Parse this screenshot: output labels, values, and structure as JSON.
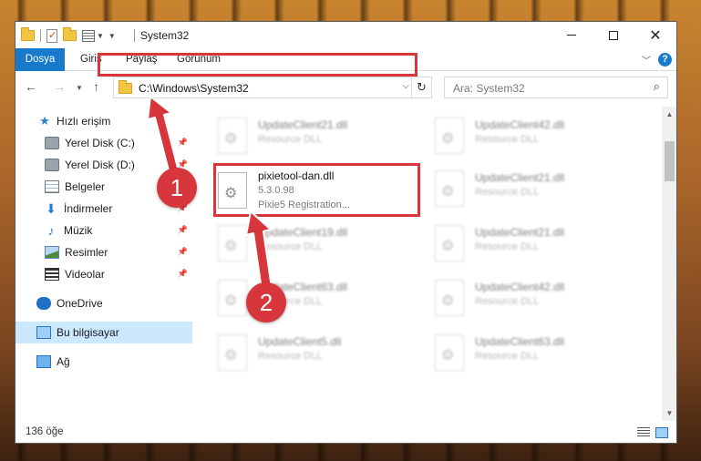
{
  "window": {
    "title": "System32"
  },
  "ribbon": {
    "tabs": [
      "Dosya",
      "Giriş",
      "Paylaş",
      "Görünüm"
    ]
  },
  "address": {
    "path": "C:\\Windows\\System32",
    "search_placeholder": "Ara: System32"
  },
  "sidebar": {
    "items": [
      {
        "label": "Hızlı erişim",
        "icon": "star-icon"
      },
      {
        "label": "Yerel Disk (C:)",
        "icon": "drive-icon",
        "pinned": true
      },
      {
        "label": "Yerel Disk (D:)",
        "icon": "drive-icon",
        "pinned": true
      },
      {
        "label": "Belgeler",
        "icon": "documents-icon",
        "pinned": true
      },
      {
        "label": "İndirmeler",
        "icon": "download-icon",
        "pinned": true
      },
      {
        "label": "Müzik",
        "icon": "music-icon",
        "pinned": true
      },
      {
        "label": "Resimler",
        "icon": "pictures-icon",
        "pinned": true
      },
      {
        "label": "Videolar",
        "icon": "videos-icon",
        "pinned": true
      },
      {
        "label": "OneDrive",
        "icon": "onedrive-icon"
      },
      {
        "label": "Bu bilgisayar",
        "icon": "this-pc-icon",
        "selected": true
      },
      {
        "label": "Ağ",
        "icon": "network-icon"
      }
    ]
  },
  "files": {
    "highlighted": {
      "name": "pixietool-dan.dll",
      "version": "5.3.0.98",
      "description": "Pixie5 Registration..."
    },
    "left_column": [
      {
        "name": "UpdateClient21.dll",
        "type": "Resource DLL"
      },
      {
        "name": "UpdateClient19.dll",
        "type": "Resource DLL"
      },
      {
        "name": "UpdateClient63.dll",
        "type": "Resource DLL"
      },
      {
        "name": "UpdateClient5.dll",
        "type": "Resource DLL"
      }
    ],
    "right_column": [
      {
        "name": "UpdateClient42.dll",
        "type": "Resource DLL"
      },
      {
        "name": "UpdateClient21.dll",
        "type": "Resource DLL"
      },
      {
        "name": "UpdateClient21.dll",
        "type": "Resource DLL"
      },
      {
        "name": "UpdateClient42.dll",
        "type": "Resource DLL"
      },
      {
        "name": "UpdateClient63.dll",
        "type": "Resource DLL"
      }
    ]
  },
  "status": {
    "item_count": "136 öğe"
  },
  "callouts": {
    "step1": "1",
    "step2": "2",
    "color": "#d7363d"
  },
  "colors": {
    "accent": "#1979ca",
    "selection": "#cce8ff",
    "highlight": "#d7363d"
  }
}
